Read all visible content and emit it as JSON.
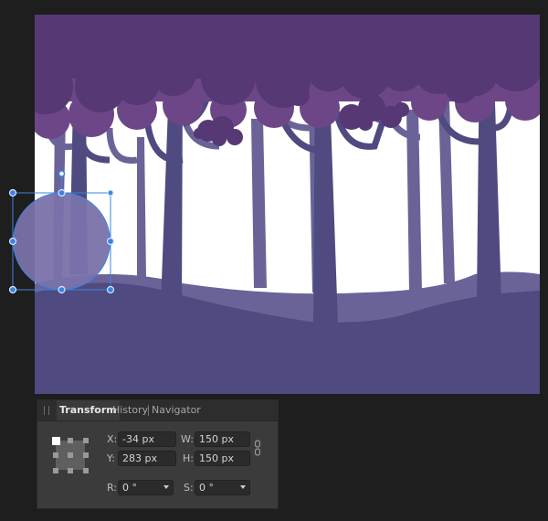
{
  "panel": {
    "tabs": [
      {
        "label": "Transform",
        "active": true
      },
      {
        "label": "History",
        "active": false
      },
      {
        "label": "Navigator",
        "active": false
      }
    ],
    "fields": {
      "x": {
        "label": "X:",
        "value": "-34 px"
      },
      "y": {
        "label": "Y:",
        "value": "283 px"
      },
      "w": {
        "label": "W:",
        "value": "150 px"
      },
      "h": {
        "label": "H:",
        "value": "150 px"
      },
      "r": {
        "label": "R:",
        "value": "0 °"
      },
      "s": {
        "label": "S:",
        "value": "0 °"
      }
    },
    "anchor_selected": "top-left",
    "link_icon": "chain-link-icon"
  },
  "colors": {
    "app_bg": "#1e1e1e",
    "panel_bg": "#3b3b3b",
    "canopy_dark": "#553874",
    "canopy_light": "#6d4687",
    "trunk_dark": "#4f4a80",
    "trunk_light": "#6a6398",
    "ground_dark": "#4f4a80",
    "ground_light": "#6a6398",
    "selection": "#3a84e0",
    "selected_circle": "#7a72aa"
  }
}
